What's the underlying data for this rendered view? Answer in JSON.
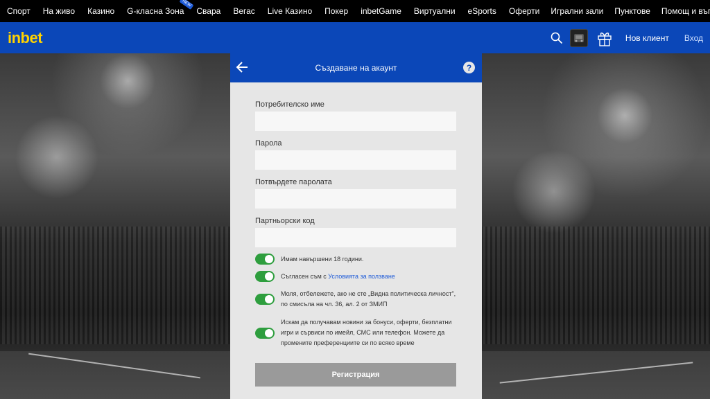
{
  "topnav": {
    "left_items": [
      "Спорт",
      "На живо",
      "Казино",
      "G-класна Зона",
      "Свара",
      "Вегас",
      "Live Казино",
      "Покер",
      "inbetGame",
      "Виртуални",
      "eSports",
      "Оферти"
    ],
    "right_items": [
      "Игрални зали",
      "Пунктове",
      "Помощ и въпроси"
    ],
    "badge": "NEW"
  },
  "brand": {
    "logo": "inbet",
    "new_client": "Нов клиент",
    "login": "Вход"
  },
  "modal": {
    "title": "Създаване на акаунт",
    "help": "?",
    "fields": [
      {
        "label": "Потребителско име",
        "value": ""
      },
      {
        "label": "Парола",
        "value": ""
      },
      {
        "label": "Потвърдете паролата",
        "value": ""
      },
      {
        "label": "Партньорски код",
        "value": ""
      }
    ],
    "toggles": [
      {
        "text": "Имам навършени 18 години.",
        "on": true
      },
      {
        "text": "Съгласен съм с",
        "link": "Условията за ползване",
        "on": true
      },
      {
        "text": "Моля, отбележете, ако не сте „Видна политическа личност\", по смисъла на чл. 36, ал. 2 от ЗМИП",
        "on": true
      },
      {
        "text": "Искам да получавам новини за бонуси, оферти, безплатни игри и сървиси по имейл, СМС или телефон. Можете да промените преференциите си по всяко време",
        "on": true
      }
    ],
    "register": "Регистрация"
  },
  "colors": {
    "brand_blue": "#0b47b8",
    "logo_yellow": "#ffd200",
    "toggle_green": "#2e9e3e",
    "register_gray": "#9a9a9a"
  }
}
